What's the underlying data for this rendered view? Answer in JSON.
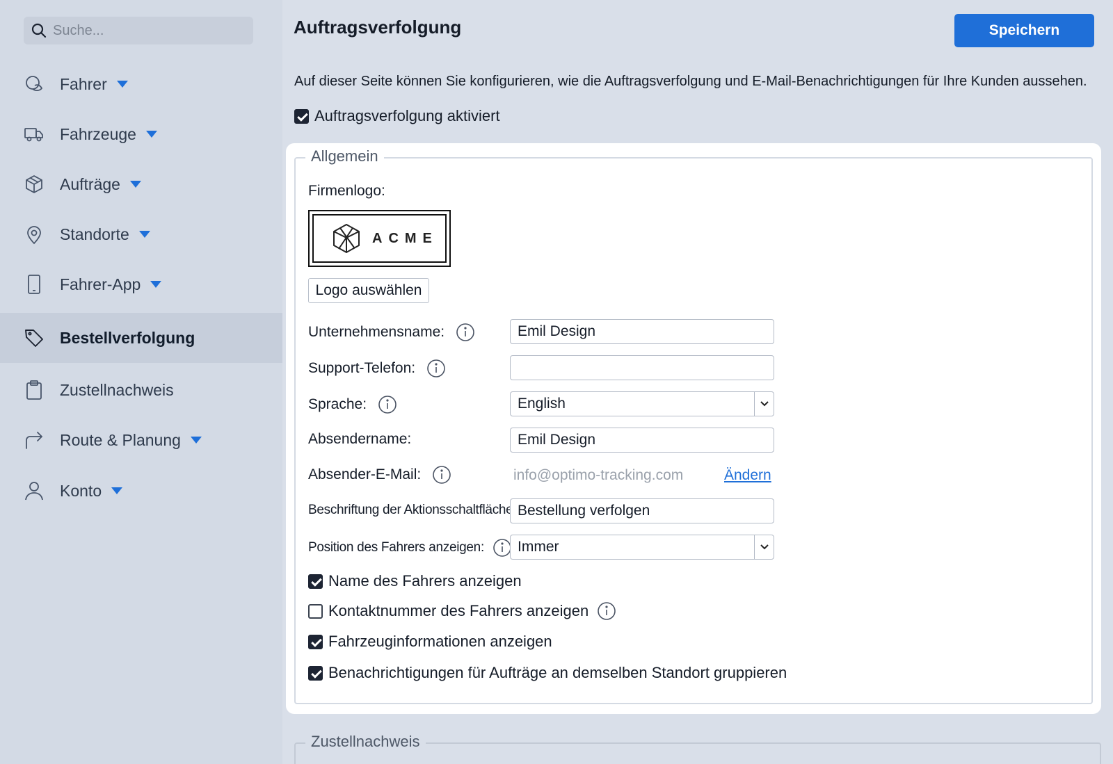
{
  "search": {
    "placeholder": "Suche..."
  },
  "sidebar": {
    "items": [
      {
        "label": "Fahrer",
        "icon": "fahrer-icon",
        "has_caret": true
      },
      {
        "label": "Fahrzeuge",
        "icon": "truck-icon",
        "has_caret": true
      },
      {
        "label": "Aufträge",
        "icon": "package-icon",
        "has_caret": true
      },
      {
        "label": "Standorte",
        "icon": "location-pin-icon",
        "has_caret": true
      },
      {
        "label": "Fahrer-App",
        "icon": "phone-icon",
        "has_caret": true
      },
      {
        "label": "Bestellverfolgung",
        "icon": "tag-icon",
        "has_caret": false,
        "active": true
      },
      {
        "label": "Zustellnachweis",
        "icon": "clipboard-icon",
        "has_caret": false
      },
      {
        "label": "Route & Planung",
        "icon": "route-arrow-icon",
        "has_caret": true
      },
      {
        "label": "Konto",
        "icon": "user-icon",
        "has_caret": true
      }
    ]
  },
  "header": {
    "title": "Auftragsverfolgung",
    "save_label": "Speichern"
  },
  "intro": "Auf dieser Seite können Sie konfigurieren, wie die Auftragsverfolgung und E-Mail-Benachrichtigungen für Ihre Kunden aussehen.",
  "tracking_enabled": {
    "label": "Auftragsverfolgung aktiviert",
    "checked": true
  },
  "general": {
    "legend": "Allgemein",
    "logo_label": "Firmenlogo:",
    "logo_text": "ACME",
    "logo_button": "Logo auswählen",
    "company_name_label": "Unternehmensname:",
    "company_name_value": "Emil Design",
    "support_phone_label": "Support-Telefon:",
    "support_phone_value": "",
    "language_label": "Sprache:",
    "language_value": "English",
    "sender_name_label": "Absendername:",
    "sender_name_value": "Emil Design",
    "sender_email_label": "Absender-E-Mail:",
    "sender_email_value": "info@optimo-tracking.com",
    "change_link": "Ändern",
    "action_button_label": "Beschriftung der Aktionsschaltfläche:",
    "action_button_value": "Bestellung verfolgen",
    "driver_position_label": "Position des Fahrers anzeigen:",
    "driver_position_value": "Immer",
    "checkboxes": [
      {
        "label": "Name des Fahrers anzeigen",
        "checked": true
      },
      {
        "label": "Kontaktnummer des Fahrers anzeigen",
        "checked": false,
        "has_info": true
      },
      {
        "label": "Fahrzeuginformationen anzeigen",
        "checked": true
      },
      {
        "label": "Benachrichtigungen für Aufträge an demselben Standort gruppieren",
        "checked": true
      }
    ]
  },
  "proof": {
    "legend": "Zustellnachweis"
  },
  "colors": {
    "accent": "#1f6fd8",
    "sidebar_bg": "#d3dae5",
    "active_bg": "#c6cedb"
  }
}
